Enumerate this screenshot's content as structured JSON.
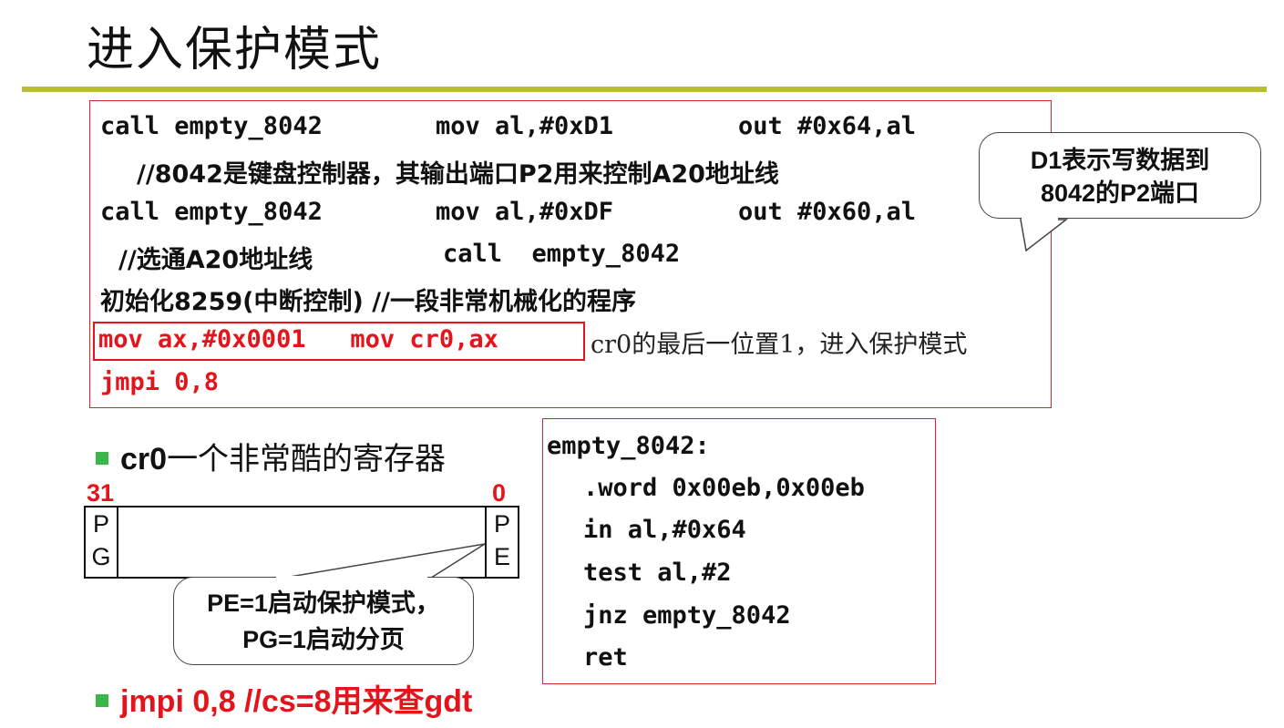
{
  "slide": {
    "title": "进入保护模式"
  },
  "code_box": {
    "line1": {
      "c1": "call empty_8042",
      "c2": "mov al,#0xD1",
      "c3": "out #0x64,al"
    },
    "line2": {
      "comment": "//8042是键盘控制器，其输出端口P2用来控制A20地址线"
    },
    "line3": {
      "c1": "call empty_8042",
      "c2": "mov al,#0xDF",
      "c3": "out #0x60,al"
    },
    "line4": {
      "comment": "//选通A20地址线",
      "code": "call  empty_8042"
    },
    "line5": {
      "text": "初始化8259(中断控制) //一段非常机械化的程序"
    },
    "line6": {
      "code": "mov ax,#0x0001   mov cr0,ax",
      "note": "cr0的最后一位置1，进入保护模式"
    },
    "line7": {
      "code": "jmpi 0,8"
    }
  },
  "callout_d1": {
    "line1": "D1表示写数据到",
    "line2": "8042的P2端口"
  },
  "bullet1": {
    "bold": "cr0",
    "text": "一个非常酷的寄存器"
  },
  "register": {
    "high_bit": "31",
    "low_bit": "0",
    "pg": [
      "P",
      "G"
    ],
    "pe": [
      "P",
      "E"
    ]
  },
  "callout_pe": {
    "line1": "PE=1启动保护模式，",
    "line2": "PG=1启动分页"
  },
  "bullet2": {
    "text": "jmpi 0,8 //cs=8用来查gdt"
  },
  "fn_box": {
    "label": "empty_8042:",
    "lines": [
      ".word 0x00eb,0x00eb",
      "in al,#0x64",
      "test al,#2",
      "jnz empty_8042",
      "ret"
    ]
  },
  "colors": {
    "accent_rule": "#b9bb3a",
    "red": "#e3141b",
    "bullet": "#3ab54a"
  }
}
